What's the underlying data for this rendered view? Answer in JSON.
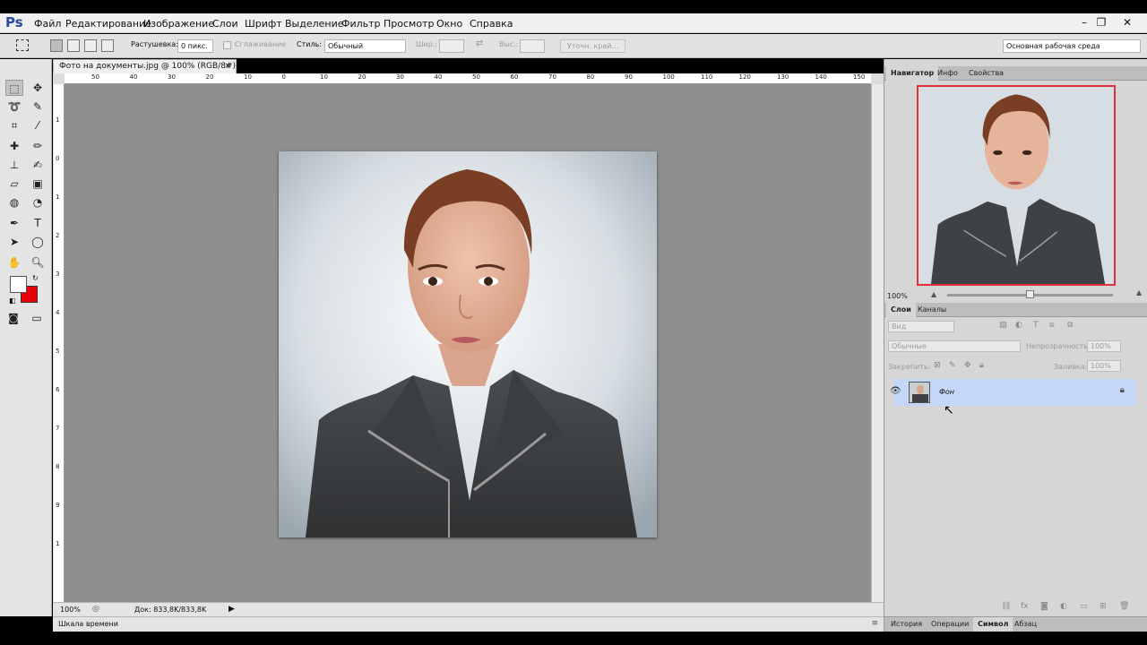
{
  "app": {
    "logo": "Ps"
  },
  "menu": [
    "Файл",
    "Редактирование",
    "Изображение",
    "Слои",
    "Шрифт",
    "Выделение",
    "Фильтр",
    "Просмотр",
    "Окно",
    "Справка"
  ],
  "window_controls": [
    "–",
    "❐",
    "✕"
  ],
  "options_bar": {
    "feather_label": "Растушевка:",
    "feather_value": "0 пикс.",
    "antialias_label": "Сглаживание",
    "style_label": "Стиль:",
    "style_value": "Обычный",
    "width_label": "Шир.:",
    "height_label": "Выс.:",
    "refine_edge": "Уточн. край...",
    "workspace": "Основная рабочая среда"
  },
  "document": {
    "tab_title": "Фото на документы.jpg @ 100% (RGB/8#)",
    "close": "×",
    "zoom": "100%",
    "doc_size": "Док: 833,8K/833,8K",
    "ruler_h": [
      "50",
      "40",
      "30",
      "20",
      "10",
      "0",
      "10",
      "20",
      "30",
      "40",
      "50",
      "60",
      "70",
      "80",
      "90",
      "100",
      "110",
      "120",
      "130",
      "140",
      "150"
    ],
    "ruler_v": [
      "1",
      "0",
      "1",
      "2",
      "3",
      "4",
      "5",
      "6",
      "7",
      "8",
      "9",
      "1"
    ]
  },
  "navigator": {
    "tabs": [
      "Навигатор",
      "Инфо",
      "Свойства"
    ],
    "zoom": "100%"
  },
  "layers": {
    "tabs": [
      "Слои",
      "Каналы"
    ],
    "filter_placeholder": "Вид",
    "blend_mode": "Обычные",
    "opacity_label": "Непрозрачность:",
    "opacity_value": "100%",
    "lock_label": "Закрепить:",
    "fill_label": "Заливка:",
    "fill_value": "100%",
    "items": [
      {
        "name": "Фон"
      }
    ]
  },
  "bottom_left": {
    "timeline": "Шкала времени"
  },
  "bottom_right_tabs": [
    "История",
    "Операции",
    "Символ",
    "Абзац"
  ],
  "colors": {
    "foreground": "#ffffff",
    "background": "#e8000a",
    "nav_frame": "#e0303a",
    "layer_selected": "#c4d7f7"
  }
}
